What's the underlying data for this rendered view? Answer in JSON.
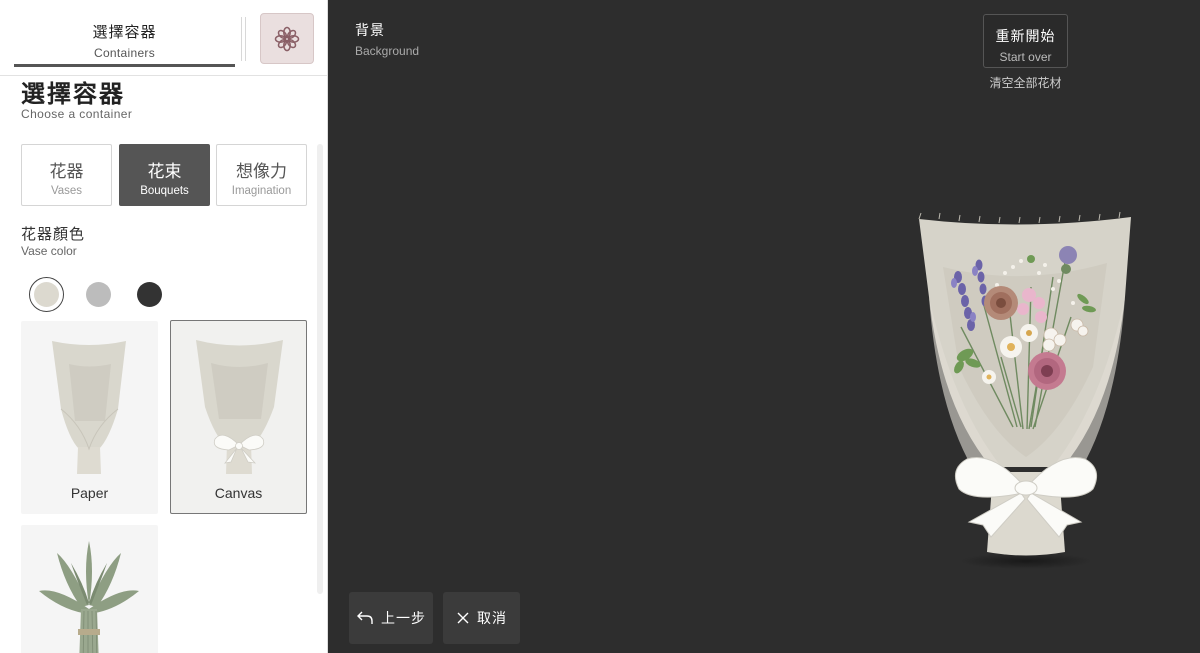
{
  "sidebar": {
    "tab": {
      "zh": "選擇容器",
      "en": "Containers"
    },
    "flower_button_icon": "flower-icon",
    "title": "選擇容器",
    "subtitle": "Choose a container",
    "categories": [
      {
        "zh": "花器",
        "en": "Vases",
        "active": false
      },
      {
        "zh": "花束",
        "en": "Bouquets",
        "active": true
      },
      {
        "zh": "想像力",
        "en": "Imagination",
        "active": false
      }
    ],
    "color_section": {
      "title": "花器顏色",
      "subtitle": "Vase color",
      "swatches": [
        {
          "name": "cream",
          "color": "#dcd9cf",
          "selected": true
        },
        {
          "name": "gray",
          "color": "#bcbcbc",
          "selected": false
        },
        {
          "name": "charcoal",
          "color": "#333333",
          "selected": false
        }
      ]
    },
    "containers": [
      {
        "label": "Paper",
        "selected": false
      },
      {
        "label": "Canvas",
        "selected": true
      },
      {
        "label": "",
        "selected": false
      }
    ]
  },
  "canvas": {
    "background": {
      "zh": "背景",
      "en": "Background"
    },
    "restart": {
      "zh": "重新開始",
      "en": "Start over"
    },
    "clear_note": "清空全部花材",
    "undo": {
      "label": "上一步",
      "icon": "undo-arrow-icon"
    },
    "cancel": {
      "label": "取消",
      "icon": "close-icon"
    },
    "background_color": "#2d2d2d"
  }
}
